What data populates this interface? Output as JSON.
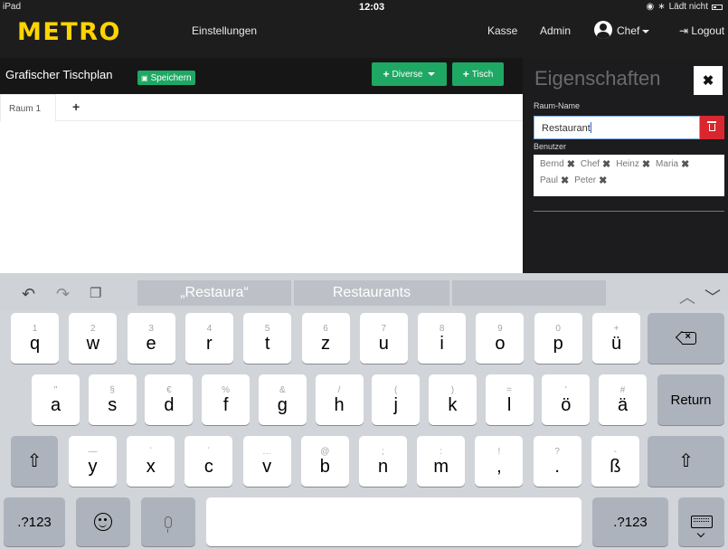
{
  "status_bar": {
    "device": "iPad",
    "time": "12:03",
    "battery_text": "Lädt nicht"
  },
  "nav": {
    "logo": "METRO",
    "settings": "Einstellungen",
    "checkout": "Kasse",
    "admin": "Admin",
    "user": "Chef",
    "logout": "Logout"
  },
  "toolbar": {
    "title": "Grafischer Tischplan",
    "save": "Speichern",
    "misc": "Diverse",
    "table": "Tisch"
  },
  "rooms": {
    "tabs": [
      "Raum 1"
    ],
    "add": "+"
  },
  "properties": {
    "title": "Eigenschaften",
    "close": "✖",
    "room_name_label": "Raum-Name",
    "room_name_value": "Restaurant",
    "users_label": "Benutzer",
    "users": [
      "Bernd",
      "Chef",
      "Heinz",
      "Maria",
      "Paul",
      "Peter"
    ]
  },
  "keyboard": {
    "suggestions": [
      "„Restaura“",
      "Restaurants",
      ""
    ],
    "row1": [
      {
        "sub": "1",
        "main": "q"
      },
      {
        "sub": "2",
        "main": "w"
      },
      {
        "sub": "3",
        "main": "e"
      },
      {
        "sub": "4",
        "main": "r"
      },
      {
        "sub": "5",
        "main": "t"
      },
      {
        "sub": "6",
        "main": "z"
      },
      {
        "sub": "7",
        "main": "u"
      },
      {
        "sub": "8",
        "main": "i"
      },
      {
        "sub": "9",
        "main": "o"
      },
      {
        "sub": "0",
        "main": "p"
      },
      {
        "sub": "+",
        "main": "ü"
      }
    ],
    "row2": [
      {
        "sub": "\"",
        "main": "a"
      },
      {
        "sub": "§",
        "main": "s"
      },
      {
        "sub": "€",
        "main": "d"
      },
      {
        "sub": "%",
        "main": "f"
      },
      {
        "sub": "&",
        "main": "g"
      },
      {
        "sub": "/",
        "main": "h"
      },
      {
        "sub": "(",
        "main": "j"
      },
      {
        "sub": ")",
        "main": "k"
      },
      {
        "sub": "=",
        "main": "l"
      },
      {
        "sub": "'",
        "main": "ö"
      },
      {
        "sub": "#",
        "main": "ä"
      }
    ],
    "row3": [
      {
        "sub": "—",
        "main": "y"
      },
      {
        "sub": "`",
        "main": "x"
      },
      {
        "sub": "´",
        "main": "c"
      },
      {
        "sub": "…",
        "main": "v"
      },
      {
        "sub": "@",
        "main": "b"
      },
      {
        "sub": ";",
        "main": "n"
      },
      {
        "sub": ":",
        "main": "m"
      },
      {
        "sub": "!",
        "main": ","
      },
      {
        "sub": "?",
        "main": "."
      },
      {
        "sub": "-",
        "main": "ß"
      }
    ],
    "return": "Return",
    "numbers": ".?123"
  }
}
